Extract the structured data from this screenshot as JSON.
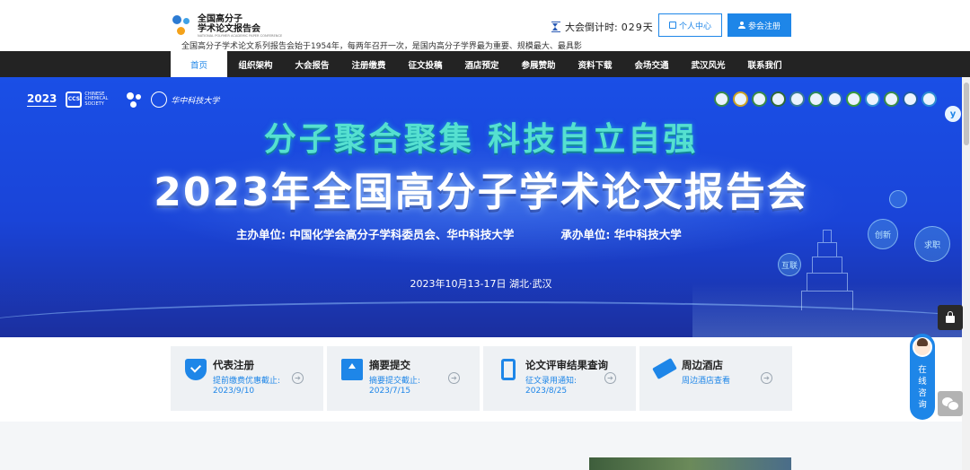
{
  "header": {
    "logo": {
      "line1": "全国高分子",
      "line2": "学术论文报告会",
      "en": "NATIONAL POLYMER ACADEMIC PAPER CONFERENCE"
    },
    "countdown": {
      "label": "大会倒计时:",
      "value": "029天"
    },
    "personal_center": "个人中心",
    "register": "参会注册"
  },
  "nav": {
    "items": [
      {
        "label": "首页",
        "active": true
      },
      {
        "label": "组织架构"
      },
      {
        "label": "大会报告"
      },
      {
        "label": "注册缴费"
      },
      {
        "label": "征文投稿"
      },
      {
        "label": "酒店预定"
      },
      {
        "label": "参展赞助"
      },
      {
        "label": "资料下载"
      },
      {
        "label": "会场交通"
      },
      {
        "label": "武汉风光"
      },
      {
        "label": "联系我们"
      }
    ]
  },
  "banner": {
    "logo_year": "2023",
    "ccs_abbr": "CCS",
    "ccs_name": "CHINESE CHEMICAL SOCIETY",
    "hust_name": "华中科技大学",
    "slogan": "分子聚合聚集  科技自立自强",
    "title": "2023年全国高分子学术论文报告会",
    "host": "主办单位: 中国化学会高分子学科委员会、华中科技大学",
    "organizer": "承办单位: 华中科技大学",
    "dates": "2023年10月13-17日  湖北·武汉",
    "bubbles": [
      "创新",
      "求职",
      "互联"
    ],
    "colors": {
      "top": "#1a4fe6",
      "bottom": "#1b2f9e",
      "slogan": "#55e0d0"
    }
  },
  "cards": [
    {
      "title": "代表注册",
      "sub": "提前缴费优惠截止:",
      "date": "2023/9/10",
      "icon": "shield-check-icon"
    },
    {
      "title": "摘要提交",
      "sub": "摘要提交截止:",
      "date": "2023/7/15",
      "icon": "upload-icon"
    },
    {
      "title": "论文评审结果查询",
      "sub": "征文录用通知:",
      "date": "2023/8/25",
      "icon": "phone-icon"
    },
    {
      "title": "周边酒店",
      "sub": "周边酒店查看",
      "date": "",
      "icon": "ticket-icon"
    }
  ],
  "intro": "全国高分子学术论文系列报告会始于1954年，每两年召开一次，是国内高分子学界最为重要、规模最大、最具影",
  "chat": {
    "label": "在线咨询"
  },
  "accent": "#1e86e8"
}
